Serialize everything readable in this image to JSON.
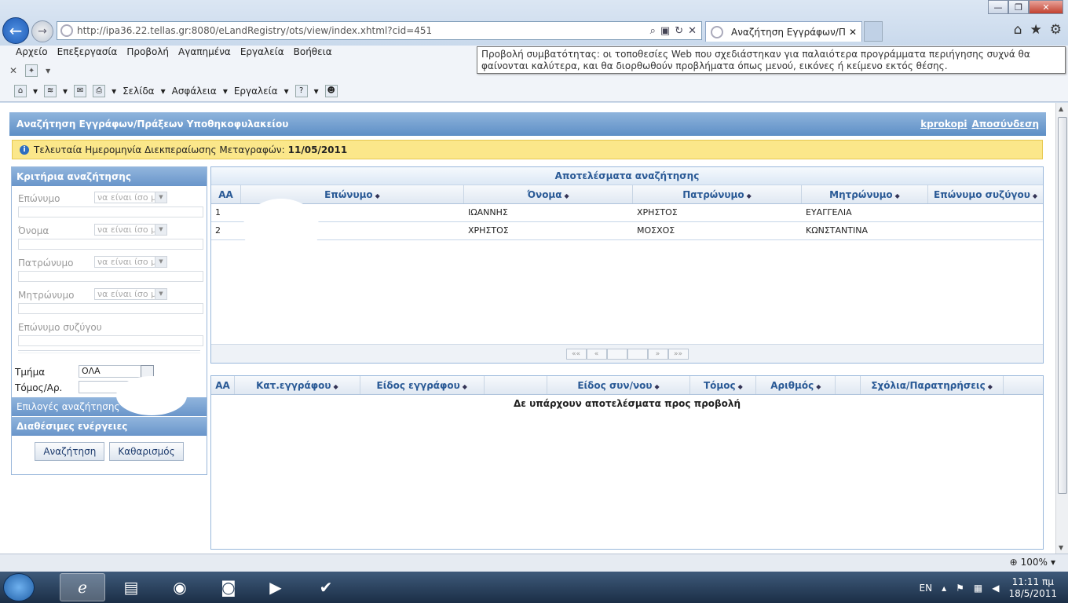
{
  "window": {
    "minimize": "—",
    "maximize": "❐",
    "close": "✕"
  },
  "browser": {
    "url": "http://ipa36.22.tellas.gr:8080/eLandRegistry/ots/view/index.xhtml?cid=451",
    "tab_title": "Αναζήτηση Εγγράφων/Πρ...",
    "tab_close": "✕"
  },
  "menu": [
    "Αρχείο",
    "Επεξεργασία",
    "Προβολή",
    "Αγαπημένα",
    "Εργαλεία",
    "Βοήθεια"
  ],
  "command_bar": {
    "page": "Σελίδα",
    "safety": "Ασφάλεια",
    "tools": "Εργαλεία"
  },
  "tooltip": "Προβολή συμβατότητας: οι τοποθεσίες Web που σχεδιάστηκαν για παλαιότερα προγράμματα περιήγησης συχνά θα φαίνονται καλύτερα, και θα διορθωθούν προβλήματα όπως μενού, εικόνες ή κείμενο εκτός θέσης.",
  "page": {
    "title": "Αναζήτηση Εγγράφων/Πράξεων Υποθηκοφυλακείου",
    "user": "kprokopi",
    "logout": "Αποσύνδεση",
    "notice_label": "Τελευταία Ημερομηνία Διεκπεραίωσης Μεταγραφών:",
    "notice_date": "11/05/2011"
  },
  "criteria": {
    "title": "Κριτήρια αναζήτησης",
    "operator": "να είναι ίσο με",
    "fields": [
      "Επώνυμο",
      "Όνομα",
      "Πατρώνυμο",
      "Μητρώνυμο"
    ],
    "spouse": "Επώνυμο συζύγου",
    "department_label": "Τμήμα",
    "department_value": "ΟΛΑ",
    "volume_label": "Τόμος/Αρ.",
    "options_title": "Επιλογές αναζήτησης",
    "actions_title": "Διαθέσιμες ενέργειες",
    "search_button": "Αναζήτηση",
    "clear_button": "Καθαρισμός"
  },
  "results": {
    "title": "Αποτελέσματα αναζήτησης",
    "columns": [
      "ΑΑ",
      "Επώνυμο",
      "Όνομα",
      "Πατρώνυμο",
      "Μητρώνυμο",
      "Επώνυμο συζύγου"
    ],
    "rows": [
      [
        "1",
        "",
        "ΙΩΑΝΝΗΣ",
        "ΧΡΗΣΤΟΣ",
        "ΕΥΑΓΓΕΛΙΑ",
        ""
      ],
      [
        "2",
        "",
        "ΧΡΗΣΤΟΣ",
        "ΜΟΣΧΟΣ",
        "ΚΩΝΣΤΑΝΤΙΝΑ",
        ""
      ]
    ],
    "pager": [
      "««",
      "«",
      "",
      "",
      "»",
      "»»"
    ]
  },
  "documents": {
    "columns": [
      "ΑΑ",
      "Κατ.εγγράφου",
      "Είδος εγγράφου",
      "",
      "Είδος συν/νου",
      "Τόμος",
      "Αριθμός",
      "",
      "Σχόλια/Παρατηρήσεις"
    ],
    "empty": "Δε υπάρχουν αποτελέσματα προς προβολή"
  },
  "status": {
    "zoom": "100%"
  },
  "taskbar": {
    "lang": "EN",
    "time": "11:11 πμ",
    "date": "18/5/2011"
  }
}
